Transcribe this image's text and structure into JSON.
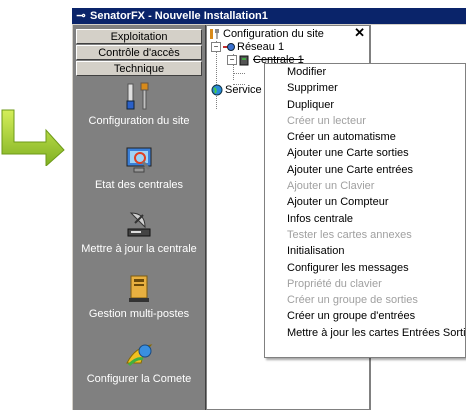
{
  "title": "SenatorFX - Nouvelle Installation1",
  "nav_buttons": [
    "Exploitation",
    "Contrôle d'accès",
    "Technique"
  ],
  "sidebar_items": [
    {
      "label": "Configuration du site",
      "icon": "tools-icon"
    },
    {
      "label": "Etat des centrales",
      "icon": "monitor-magnifier-icon"
    },
    {
      "label": "Mettre à jour la centrale",
      "icon": "satellite-dish-icon"
    },
    {
      "label": "Gestion multi-postes",
      "icon": "server-computer-icon"
    },
    {
      "label": "Configurer la Comete",
      "icon": "comet-icon"
    }
  ],
  "tree": {
    "root": "Configuration du site",
    "close": "✕",
    "reseau": "Réseau 1",
    "centrale": "Centrale 1",
    "service": "Service v"
  },
  "context_menu": [
    {
      "label": "Modifier",
      "enabled": true
    },
    {
      "label": "Supprimer",
      "enabled": true
    },
    {
      "label": "Dupliquer",
      "enabled": true
    },
    {
      "label": "Créer un lecteur",
      "enabled": false
    },
    {
      "label": "Créer un automatisme",
      "enabled": true
    },
    {
      "label": "Ajouter une Carte sorties",
      "enabled": true
    },
    {
      "label": "Ajouter une Carte entrées",
      "enabled": true
    },
    {
      "label": "Ajouter un Clavier",
      "enabled": false
    },
    {
      "label": "Ajouter un Compteur",
      "enabled": true
    },
    {
      "label": "Infos centrale",
      "enabled": true
    },
    {
      "label": "Tester les cartes annexes",
      "enabled": false
    },
    {
      "label": "Initialisation",
      "enabled": true
    },
    {
      "label": "Configurer les messages",
      "enabled": true
    },
    {
      "label": "Propriété du clavier",
      "enabled": false
    },
    {
      "label": "Créer un groupe de sorties",
      "enabled": false
    },
    {
      "label": "Créer un groupe d'entrées",
      "enabled": true
    },
    {
      "label": "Mettre à jour les cartes Entrées Sorties",
      "enabled": true
    }
  ],
  "colors": {
    "titlebar": "#0a246a",
    "sidebar": "#808080",
    "arrow": "#9acd32",
    "disabled_text": "#a0a0a0"
  }
}
